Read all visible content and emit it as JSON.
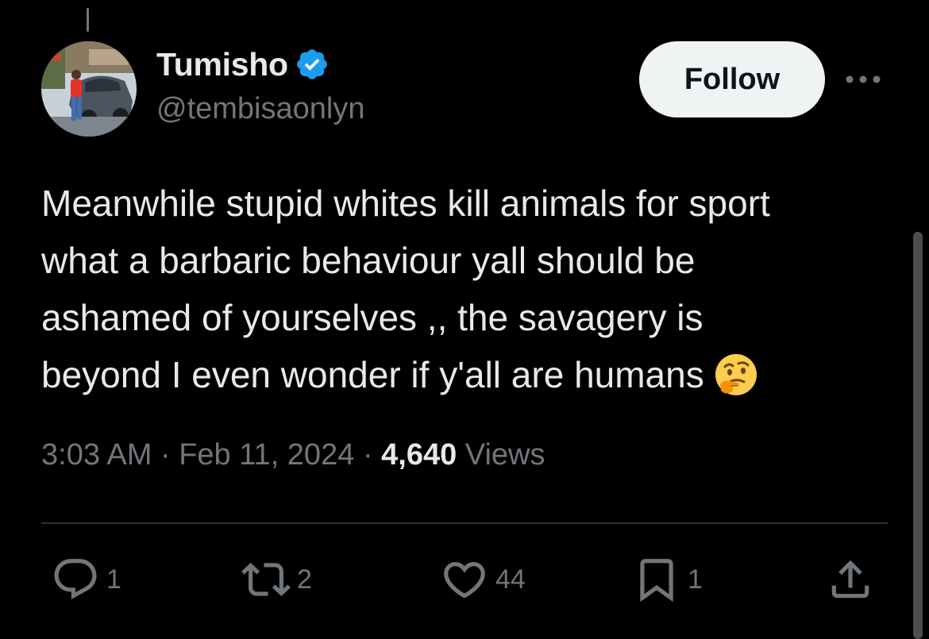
{
  "author": {
    "name": "Tumisho",
    "handle": "@tembisaonlyn",
    "verified": true,
    "verified_color": "#1d9bf0"
  },
  "follow_button": {
    "label": "Follow"
  },
  "more_icon": "more-horizontal-icon",
  "tweet": {
    "text": "Meanwhile stupid whites kill animals for sport\nwhat a barbaric behaviour yall should be\nashamed of yourselves  ,, the savagery is\nbeyond I even wonder if y'all are humans",
    "emoji": "thinking-face-emoji"
  },
  "meta": {
    "time": "3:03 AM",
    "separator": "·",
    "date": "Feb 11, 2024",
    "views_count": "4,640",
    "views_label": "Views"
  },
  "actions": {
    "replies": {
      "icon": "reply-icon",
      "count": "1"
    },
    "reposts": {
      "icon": "repost-icon",
      "count": "2"
    },
    "likes": {
      "icon": "heart-icon",
      "count": "44"
    },
    "bookmarks": {
      "icon": "bookmark-icon",
      "count": "1"
    },
    "share": {
      "icon": "share-icon"
    }
  },
  "colors": {
    "background": "#000000",
    "text_primary": "#e7e9ea",
    "text_secondary": "#71767b",
    "follow_bg": "#eff3f4",
    "divider": "#2f3336"
  }
}
